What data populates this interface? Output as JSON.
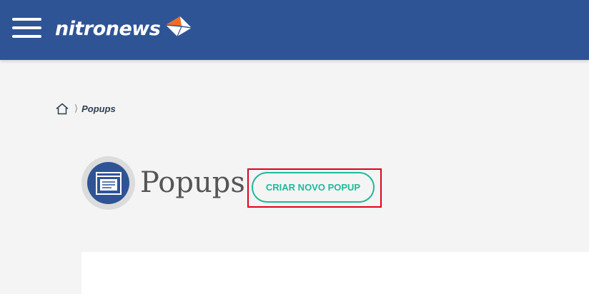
{
  "header": {
    "brand": "nitronews",
    "menu_icon": "hamburger-menu-icon",
    "logo_icon": "envelope-icon",
    "colors": {
      "bar": "#2f5496",
      "accent": "#f26b21"
    }
  },
  "breadcrumb": {
    "home_icon": "home-icon",
    "separator": "⟩",
    "current": "Popups"
  },
  "page": {
    "icon": "popup-window-icon",
    "title": "Popups",
    "create_button_label": "CRIAR NOVO POPUP",
    "button_color": "#1fb99a",
    "highlight_color": "#e0001b"
  }
}
